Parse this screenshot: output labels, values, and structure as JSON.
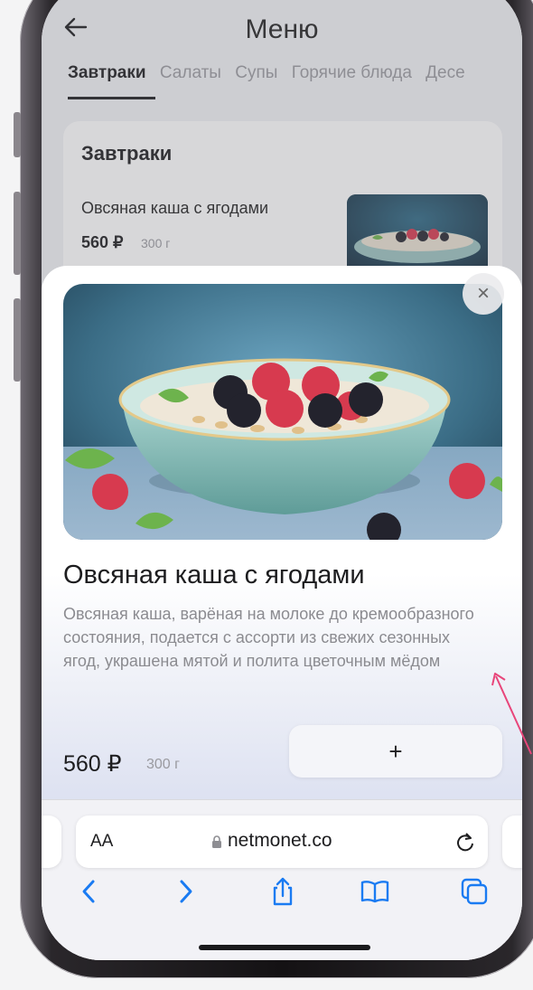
{
  "header": {
    "title": "Меню",
    "tabs": [
      {
        "label": "Завтраки",
        "active": true
      },
      {
        "label": "Салаты",
        "active": false
      },
      {
        "label": "Супы",
        "active": false
      },
      {
        "label": "Горячие блюда",
        "active": false
      },
      {
        "label": "Десе",
        "active": false
      }
    ]
  },
  "section": {
    "title": "Завтраки",
    "item": {
      "name": "Овсяная каша с ягодами",
      "price": "560 ₽",
      "weight": "300 г"
    }
  },
  "sheet": {
    "title": "Овсяная каша с ягодами",
    "description": "Овсяная каша, варёная на молоке до кремообразного состояния, подается с ассорти из свежих сезонных ягод, украшена мятой и полита цветочным мёдом",
    "price": "560 ₽",
    "weight": "300 г",
    "add_label": "+",
    "close_label": "×"
  },
  "browser": {
    "reader_label": "AA",
    "url": "netmonet.co"
  },
  "icons": [
    "back-arrow-icon",
    "close-icon",
    "lock-icon",
    "reload-icon",
    "chevron-left-icon",
    "chevron-right-icon",
    "share-icon",
    "bookmarks-icon",
    "tabs-icon"
  ],
  "colors": {
    "accent": "#1a7bf2",
    "annotation": "#e8457a",
    "text_primary": "#1d1d1f",
    "text_secondary": "#8b8b90"
  }
}
